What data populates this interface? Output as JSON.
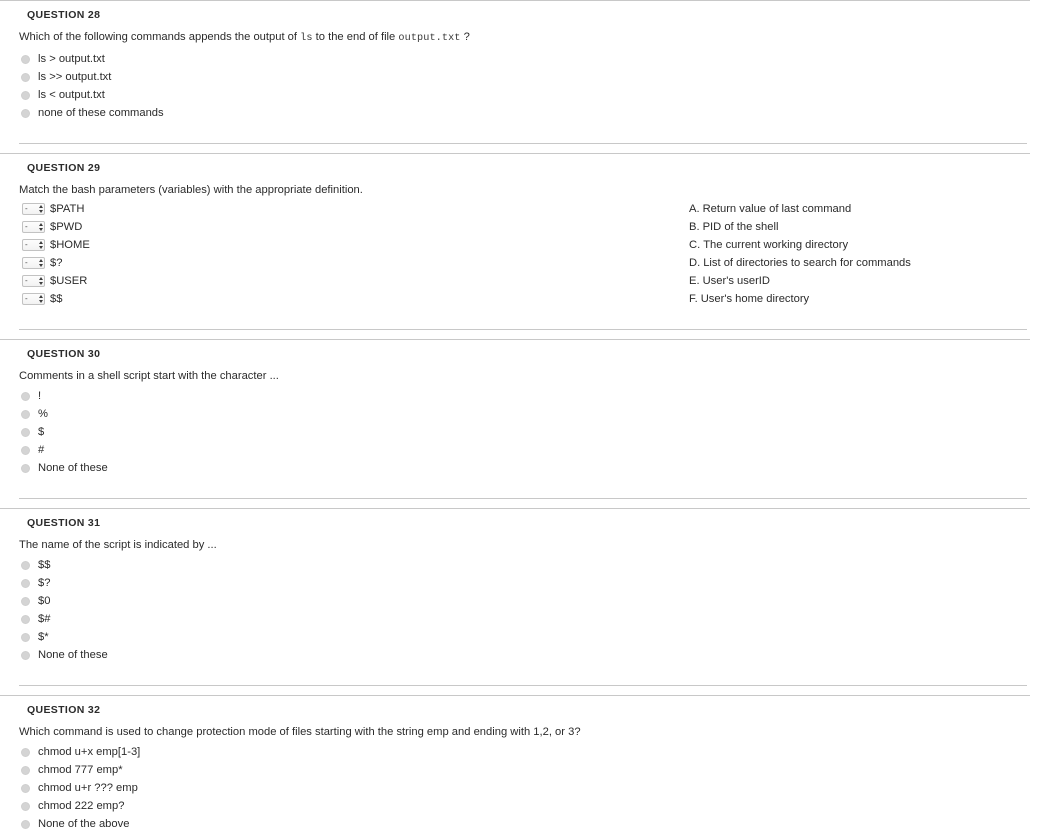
{
  "quiz": {
    "questions": [
      {
        "id": "q28",
        "header": "QUESTION 28",
        "type": "multiple-choice",
        "prompt_parts": [
          {
            "kind": "text",
            "text": "Which of the following commands appends the output of "
          },
          {
            "kind": "code",
            "text": "ls"
          },
          {
            "kind": "text",
            "text": " to the end of file "
          },
          {
            "kind": "code",
            "text": "output.txt"
          },
          {
            "kind": "text",
            "text": " ?"
          }
        ],
        "choices": [
          "ls > output.txt",
          "ls >> output.txt",
          "ls < output.txt",
          "none of these commands"
        ]
      },
      {
        "id": "q29",
        "header": "QUESTION 29",
        "type": "matching",
        "prompt": "Match the bash parameters (variables) with the appropriate definition.",
        "select_placeholder": "-",
        "terms": [
          "$PATH",
          "$PWD",
          "$HOME",
          "$?",
          "$USER",
          "$$"
        ],
        "definitions": [
          {
            "key": "A.",
            "text": "Return value of last command"
          },
          {
            "key": "B.",
            "text": "PID of the shell"
          },
          {
            "key": "C.",
            "text": "The current working directory"
          },
          {
            "key": "D.",
            "text": "List of directories to search for commands"
          },
          {
            "key": "E.",
            "text": "User's userID"
          },
          {
            "key": "F.",
            "text": "User's home directory"
          }
        ]
      },
      {
        "id": "q30",
        "header": "QUESTION 30",
        "type": "multiple-choice",
        "prompt": "Comments in a shell script start with the character ...",
        "choices": [
          "!",
          "%",
          "$",
          "#",
          "None of these"
        ]
      },
      {
        "id": "q31",
        "header": "QUESTION 31",
        "type": "multiple-choice",
        "prompt": "The name of the script is indicated by ...",
        "choices": [
          "$$",
          "$?",
          "$0",
          "$#",
          "$*",
          "None of these"
        ]
      },
      {
        "id": "q32",
        "header": "QUESTION 32",
        "type": "multiple-choice",
        "prompt": "Which command is used to change protection mode of files starting with the string emp and ending with 1,2, or 3?",
        "choices": [
          "chmod u+x emp[1-3]",
          "chmod 777 emp*",
          "chmod u+r ??? emp",
          "chmod 222 emp?",
          "None of the above"
        ]
      }
    ]
  },
  "colors": {
    "rule": "#c8c8c8",
    "text": "#2b2b2b",
    "radio": "#d4d4d4",
    "code": "#3a3a3a"
  }
}
